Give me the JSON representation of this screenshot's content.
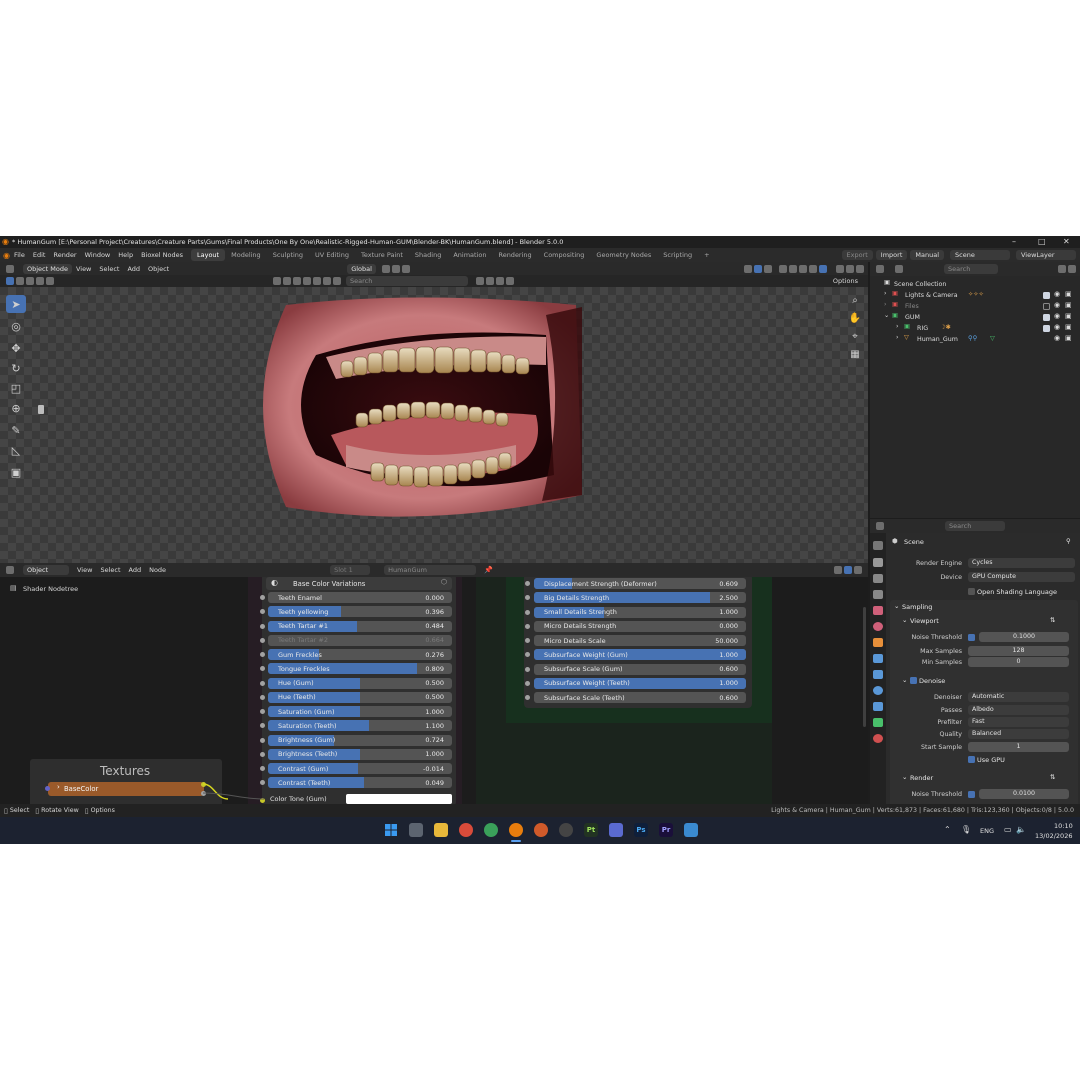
{
  "window": {
    "title": "* HumanGum [E:\\Personal Project\\Creatures\\Creature Parts\\Gums\\Final Products\\One By One\\Realistic-Rigged-Human-GUM\\Blender-BK\\HumanGum.blend] - Blender 5.0.0"
  },
  "menu": {
    "items": [
      "File",
      "Edit",
      "Render",
      "Window",
      "Help",
      "Bioxel Nodes"
    ]
  },
  "workspaces": {
    "tabs": [
      "Layout",
      "Modeling",
      "Sculpting",
      "UV Editing",
      "Texture Paint",
      "Shading",
      "Animation",
      "Rendering",
      "Compositing",
      "Geometry Nodes",
      "Scripting"
    ],
    "active": "Layout",
    "add": "+"
  },
  "topright": {
    "export": "Export",
    "import": "Import",
    "manual": "Manual",
    "scene": "Scene",
    "viewlayer": "ViewLayer"
  },
  "viewport_header": {
    "mode": "Object Mode",
    "menus": [
      "View",
      "Select",
      "Add",
      "Object"
    ],
    "orientation": "Global",
    "search_placeholder": "Search",
    "options": "Options"
  },
  "outliner": {
    "search_placeholder": "Search",
    "root": "Scene Collection",
    "items": [
      {
        "label": "Lights & Camera"
      },
      {
        "label": "Files"
      },
      {
        "label": "GUM"
      },
      {
        "label": "RIG"
      },
      {
        "label": "Human_Gum"
      }
    ]
  },
  "properties": {
    "search_placeholder": "Search",
    "context": "Scene",
    "render_engine_label": "Render Engine",
    "render_engine": "Cycles",
    "device_label": "Device",
    "device": "GPU Compute",
    "osl_label": "Open Shading Language",
    "sampling": "Sampling",
    "viewport": "Viewport",
    "noise_threshold_label": "Noise Threshold",
    "vp_noise_threshold": "0.1000",
    "max_samples_label": "Max Samples",
    "vp_max_samples": "128",
    "min_samples_label": "Min Samples",
    "vp_min_samples": "0",
    "denoise": "Denoise",
    "denoiser_label": "Denoiser",
    "denoiser": "Automatic",
    "passes_label": "Passes",
    "passes": "Albedo",
    "prefilter_label": "Prefilter",
    "prefilter": "Fast",
    "quality_label": "Quality",
    "quality": "Balanced",
    "start_sample_label": "Start Sample",
    "start_sample": "1",
    "use_gpu_label": "Use GPU",
    "render": "Render",
    "render_noise_threshold": "0.0100"
  },
  "node_header": {
    "type": "Object",
    "menus": [
      "View",
      "Select",
      "Add",
      "Node"
    ],
    "slot": "Slot 1",
    "material": "HumanGum"
  },
  "node_editor": {
    "tree_label": "Shader Nodetree",
    "left_node": {
      "title": "Base Color Variations",
      "rows": [
        {
          "label": "Teeth Enamel",
          "value": "0.000",
          "fill": 0.0
        },
        {
          "label": "Teeth yellowing",
          "value": "0.396",
          "fill": 0.396
        },
        {
          "label": "Teeth Tartar #1",
          "value": "0.484",
          "fill": 0.484
        },
        {
          "label": "Teeth Tartar #2",
          "value": "0.664",
          "fill": 0.0,
          "dim": true
        },
        {
          "label": "Gum Freckles",
          "value": "0.276",
          "fill": 0.276
        },
        {
          "label": "Tongue Freckles",
          "value": "0.809",
          "fill": 0.809
        },
        {
          "label": "Hue (Gum)",
          "value": "0.500",
          "fill": 0.5
        },
        {
          "label": "Hue (Teeth)",
          "value": "0.500",
          "fill": 0.5
        },
        {
          "label": "Saturation (Gum)",
          "value": "1.000",
          "fill": 0.5
        },
        {
          "label": "Saturation (Teeth)",
          "value": "1.100",
          "fill": 0.55
        },
        {
          "label": "Brightness (Gum)",
          "value": "0.724",
          "fill": 0.36
        },
        {
          "label": "Brightness (Teeth)",
          "value": "1.000",
          "fill": 0.5
        },
        {
          "label": "Contrast (Gum)",
          "value": "-0.014",
          "fill": 0.49
        },
        {
          "label": "Contrast (Teeth)",
          "value": "0.049",
          "fill": 0.52
        }
      ],
      "last_row_label": "Color Tone (Gum)"
    },
    "right_node": {
      "rows": [
        {
          "label": "Displacement Strength (Deformer)",
          "value": "0.609",
          "fill": 0.18
        },
        {
          "label": "Big Details Strength",
          "value": "2.500",
          "fill": 0.83
        },
        {
          "label": "Small Details Strength",
          "value": "1.000",
          "fill": 0.33
        },
        {
          "label": "Micro Details Strength",
          "value": "0.000",
          "fill": 0.0
        },
        {
          "label": "Micro Details Scale",
          "value": "50.000",
          "fill": 0.0
        },
        {
          "label": "Subsurface Weight (Gum)",
          "value": "1.000",
          "fill": 1.0
        },
        {
          "label": "Subsurface Scale (Gum)",
          "value": "0.600",
          "fill": 0.0
        },
        {
          "label": "Subsurface Weight (Teeth)",
          "value": "1.000",
          "fill": 1.0
        },
        {
          "label": "Subsurface Scale (Teeth)",
          "value": "0.600",
          "fill": 0.0
        }
      ]
    },
    "textures_frame": "Textures",
    "basecolor_node": "BaseColor"
  },
  "statusbar": {
    "select": "Select",
    "rotate": "Rotate View",
    "options": "Options",
    "stats": "Lights & Camera | Human_Gum | Verts:61,873 | Faces:61,680 | Tris:123,360 | Objects:0/8 | 5.0.0"
  },
  "taskbar": {
    "lang": "ENG",
    "time": "10:10",
    "date": "13/02/2026"
  },
  "colors": {
    "accent": "#4772b3",
    "background": "#1d1d1d",
    "panel": "#2b2b2b"
  }
}
